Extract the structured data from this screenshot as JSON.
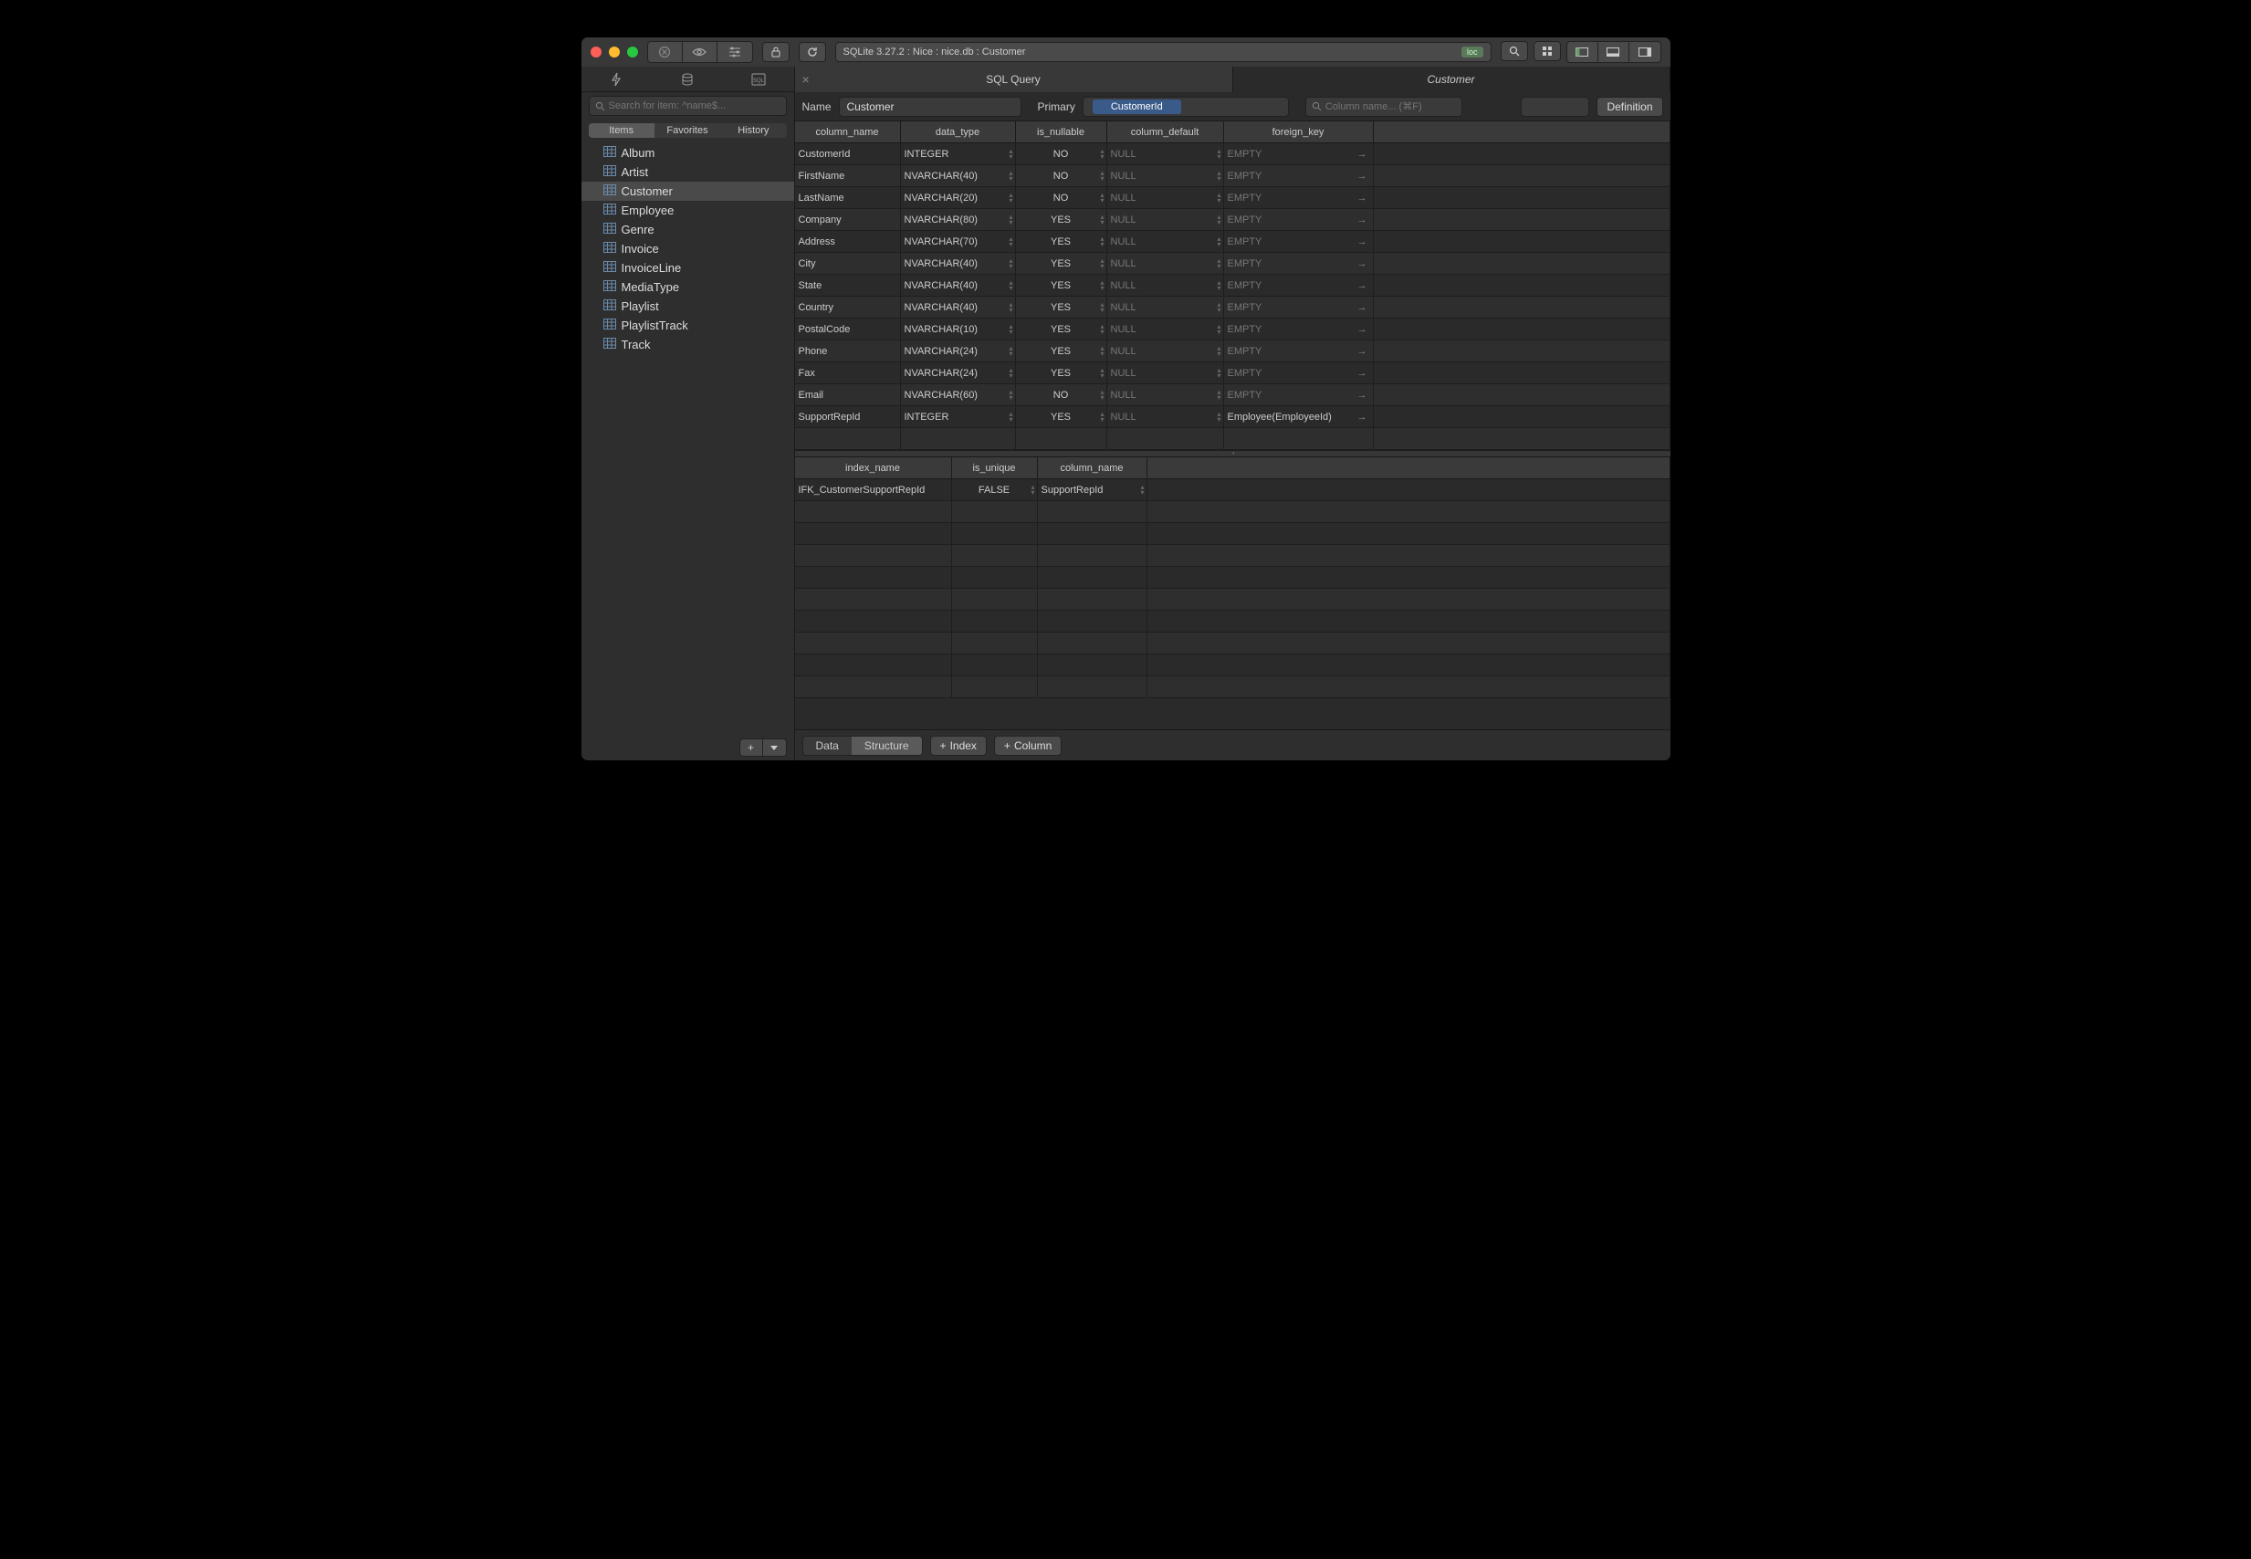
{
  "breadcrumb": "SQLite 3.27.2 : Nice : nice.db : Customer",
  "loc_badge": "loc",
  "sidebar": {
    "search_placeholder": "Search for item: ^name$...",
    "segments": [
      "Items",
      "Favorites",
      "History"
    ],
    "items": [
      {
        "label": "Album"
      },
      {
        "label": "Artist"
      },
      {
        "label": "Customer",
        "selected": true
      },
      {
        "label": "Employee"
      },
      {
        "label": "Genre"
      },
      {
        "label": "Invoice"
      },
      {
        "label": "InvoiceLine"
      },
      {
        "label": "MediaType"
      },
      {
        "label": "Playlist"
      },
      {
        "label": "PlaylistTrack"
      },
      {
        "label": "Track"
      }
    ]
  },
  "tabs": {
    "sql_query": "SQL Query",
    "active": "Customer"
  },
  "table_toolbar": {
    "name_label": "Name",
    "name_value": "Customer",
    "primary_label": "Primary",
    "primary_value": "CustomerId",
    "col_search_placeholder": "Column name... (⌘F)",
    "definition": "Definition"
  },
  "columns_grid": {
    "headers": [
      "column_name",
      "data_type",
      "is_nullable",
      "column_default",
      "foreign_key"
    ],
    "rows": [
      {
        "name": "CustomerId",
        "type": "INTEGER",
        "nullable": "NO",
        "default": "NULL",
        "fk": "EMPTY",
        "fk_dim": true
      },
      {
        "name": "FirstName",
        "type": "NVARCHAR(40)",
        "nullable": "NO",
        "default": "NULL",
        "fk": "EMPTY",
        "fk_dim": true
      },
      {
        "name": "LastName",
        "type": "NVARCHAR(20)",
        "nullable": "NO",
        "default": "NULL",
        "fk": "EMPTY",
        "fk_dim": true
      },
      {
        "name": "Company",
        "type": "NVARCHAR(80)",
        "nullable": "YES",
        "default": "NULL",
        "fk": "EMPTY",
        "fk_dim": true
      },
      {
        "name": "Address",
        "type": "NVARCHAR(70)",
        "nullable": "YES",
        "default": "NULL",
        "fk": "EMPTY",
        "fk_dim": true
      },
      {
        "name": "City",
        "type": "NVARCHAR(40)",
        "nullable": "YES",
        "default": "NULL",
        "fk": "EMPTY",
        "fk_dim": true
      },
      {
        "name": "State",
        "type": "NVARCHAR(40)",
        "nullable": "YES",
        "default": "NULL",
        "fk": "EMPTY",
        "fk_dim": true
      },
      {
        "name": "Country",
        "type": "NVARCHAR(40)",
        "nullable": "YES",
        "default": "NULL",
        "fk": "EMPTY",
        "fk_dim": true
      },
      {
        "name": "PostalCode",
        "type": "NVARCHAR(10)",
        "nullable": "YES",
        "default": "NULL",
        "fk": "EMPTY",
        "fk_dim": true
      },
      {
        "name": "Phone",
        "type": "NVARCHAR(24)",
        "nullable": "YES",
        "default": "NULL",
        "fk": "EMPTY",
        "fk_dim": true
      },
      {
        "name": "Fax",
        "type": "NVARCHAR(24)",
        "nullable": "YES",
        "default": "NULL",
        "fk": "EMPTY",
        "fk_dim": true
      },
      {
        "name": "Email",
        "type": "NVARCHAR(60)",
        "nullable": "NO",
        "default": "NULL",
        "fk": "EMPTY",
        "fk_dim": true
      },
      {
        "name": "SupportRepId",
        "type": "INTEGER",
        "nullable": "YES",
        "default": "NULL",
        "fk": "Employee(EmployeeId)",
        "fk_dim": false
      }
    ]
  },
  "index_grid": {
    "headers": [
      "index_name",
      "is_unique",
      "column_name"
    ],
    "rows": [
      {
        "name": "IFK_CustomerSupportRepId",
        "unique": "FALSE",
        "column": "SupportRepId"
      }
    ]
  },
  "footer": {
    "data": "Data",
    "structure": "Structure",
    "index": "Index",
    "column": "Column"
  }
}
